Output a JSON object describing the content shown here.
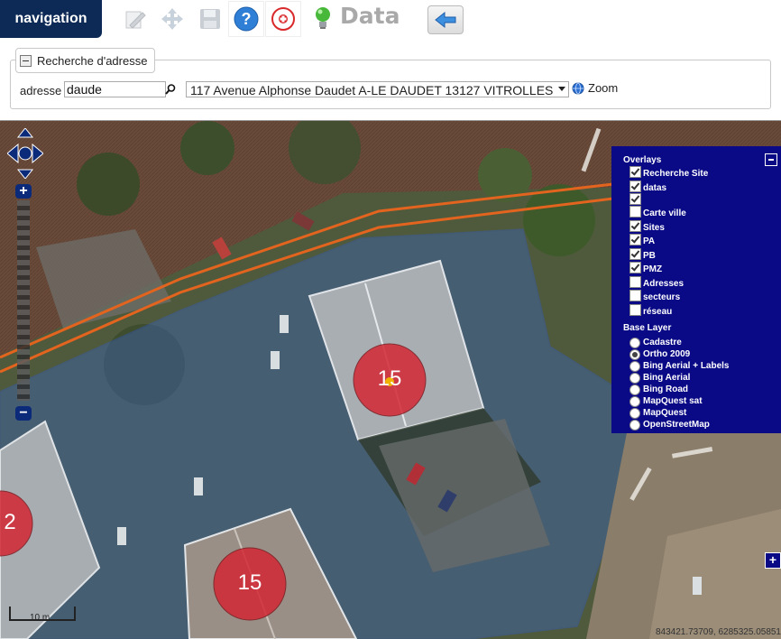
{
  "toolbar": {
    "nav_label": "navigation",
    "data_label": "Data",
    "icons": [
      "edit-icon",
      "move-icon",
      "save-icon",
      "help-icon",
      "add-icon",
      "lightbulb-icon",
      "back-arrow-icon"
    ],
    "colors": {
      "nav_bg": "#0c2a55",
      "help": "#2f7fd6",
      "add": "#d9292b",
      "bulb": "#48b83a"
    }
  },
  "search": {
    "legend": "Recherche d'adresse",
    "address_label": "adresse",
    "address_value": "daude",
    "selected_result": "117 Avenue Alphonse Daudet A-LE DAUDET 13127 VITROLLES",
    "zoom_label": "Zoom"
  },
  "layer_switcher": {
    "overlays_title": "Overlays",
    "overlays": [
      {
        "label": "Recherche Site",
        "checked": true
      },
      {
        "label": "datas",
        "checked": true
      },
      {
        "label": "",
        "checked": true
      },
      {
        "label": "Carte ville",
        "checked": false
      },
      {
        "label": "Sites",
        "checked": true
      },
      {
        "label": "PA",
        "checked": true
      },
      {
        "label": "PB",
        "checked": true
      },
      {
        "label": "PMZ",
        "checked": true
      },
      {
        "label": "Adresses",
        "checked": false
      },
      {
        "label": "secteurs",
        "checked": false
      },
      {
        "label": "réseau",
        "checked": false
      }
    ],
    "base_title": "Base Layer",
    "base_layers": [
      {
        "label": "Cadastre",
        "selected": false
      },
      {
        "label": "Ortho 2009",
        "selected": true
      },
      {
        "label": "Bing Aerial + Labels",
        "selected": false
      },
      {
        "label": "Bing Aerial",
        "selected": false
      },
      {
        "label": "Bing Road",
        "selected": false
      },
      {
        "label": "MapQuest sat",
        "selected": false
      },
      {
        "label": "MapQuest",
        "selected": false
      },
      {
        "label": "OpenStreetMap",
        "selected": false
      }
    ]
  },
  "map": {
    "clusters": [
      {
        "label": "15"
      },
      {
        "label": "15"
      },
      {
        "label": "2"
      }
    ],
    "scale_label": "10 m",
    "coords": "843421.73709, 6285325.05851",
    "colors": {
      "cluster": "#d32733",
      "zone": "#3a66c8",
      "pipe": "#e2641e",
      "panel": "#0a0a87"
    }
  }
}
